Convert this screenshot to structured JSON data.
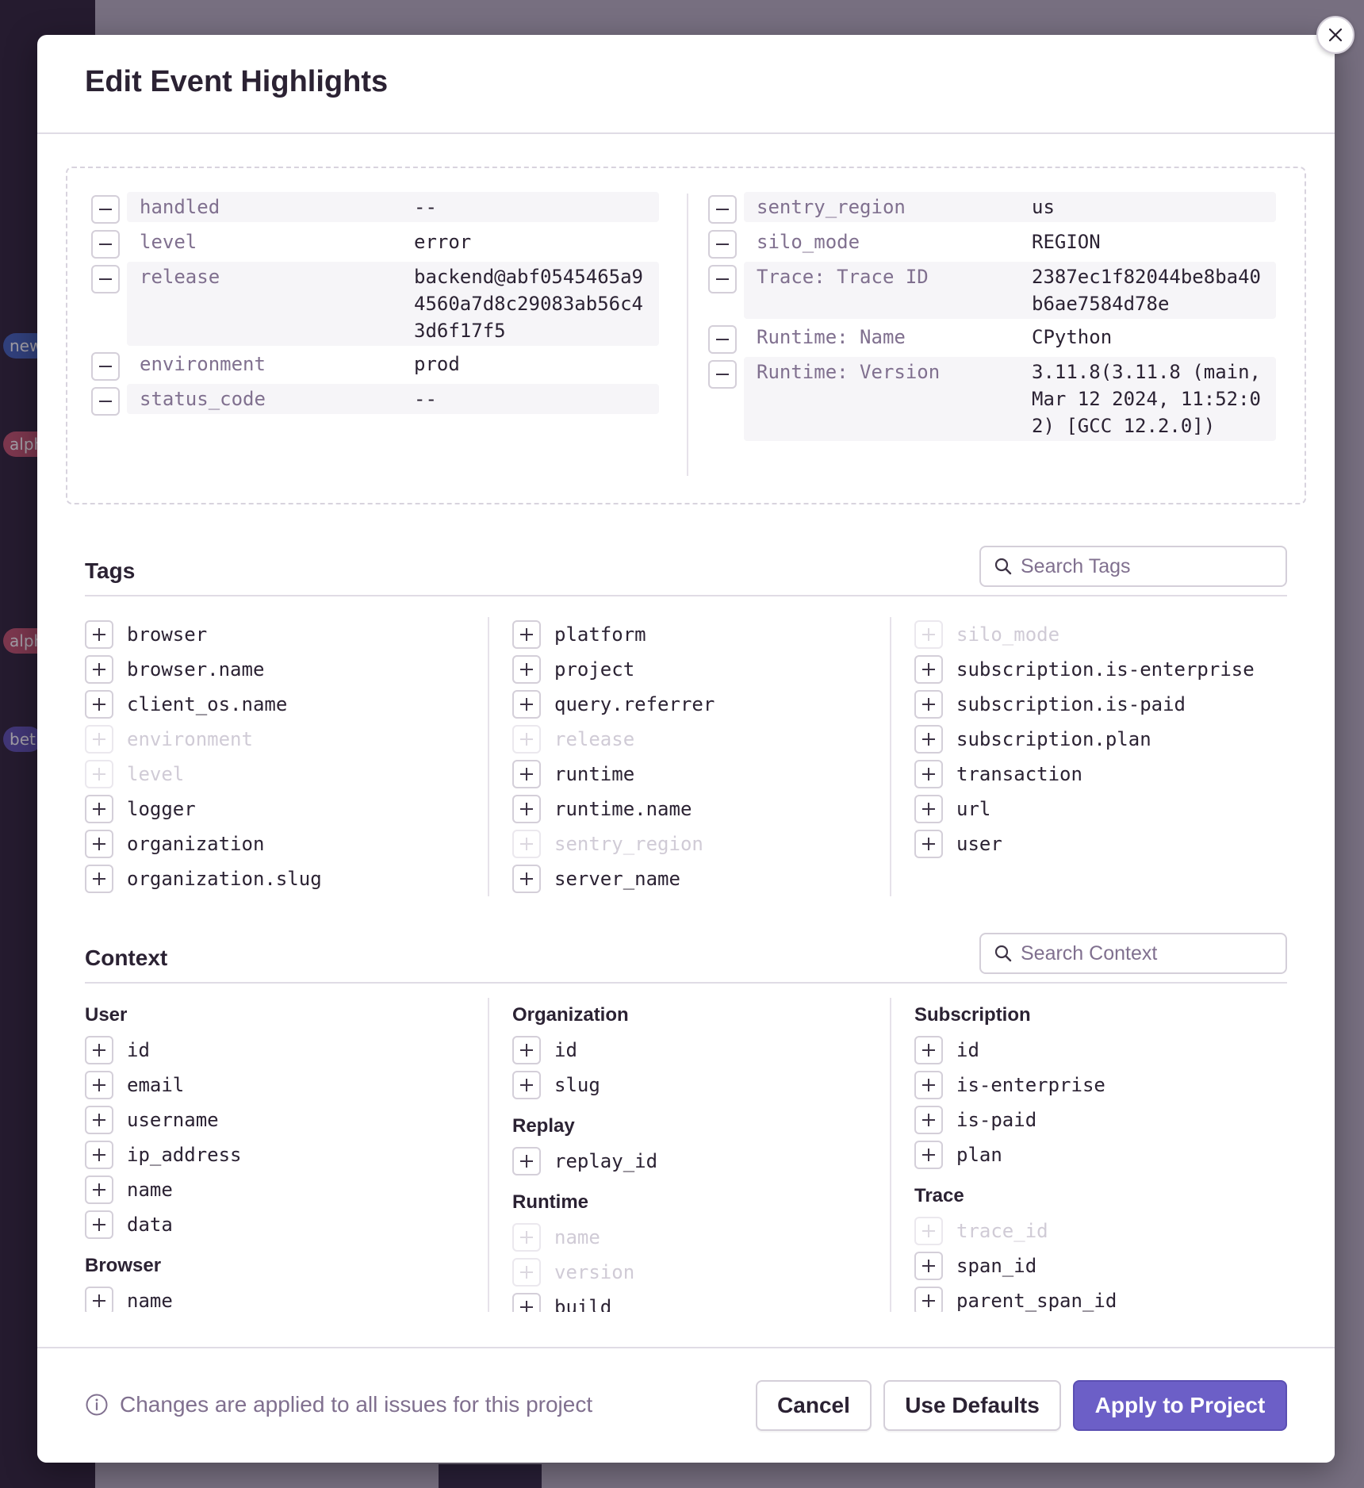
{
  "modal": {
    "title": "Edit Event Highlights"
  },
  "highlights": {
    "left": [
      {
        "key": "handled",
        "value": "--",
        "shaded": true
      },
      {
        "key": "level",
        "value": "error",
        "shaded": false
      },
      {
        "key": "release",
        "value": "backend@abf0545465a94560a7d8c29083ab56c43d6f17f5",
        "shaded": true
      },
      {
        "key": "environment",
        "value": "prod",
        "shaded": false
      },
      {
        "key": "status_code",
        "value": "--",
        "shaded": true
      }
    ],
    "right": [
      {
        "key": "sentry_region",
        "value": "us",
        "shaded": true
      },
      {
        "key": "silo_mode",
        "value": "REGION",
        "shaded": false
      },
      {
        "key": "Trace: Trace ID",
        "value": "2387ec1f82044be8ba40b6ae7584d78e",
        "shaded": true
      },
      {
        "key": "Runtime: Name",
        "value": "CPython",
        "shaded": false
      },
      {
        "key": "Runtime: Version",
        "value": "3.11.8(3.11.8 (main, Mar 12 2024, 11:52:02) [GCC 12.2.0])",
        "shaded": true
      }
    ]
  },
  "tags": {
    "title": "Tags",
    "search_placeholder": "Search Tags",
    "columns": [
      [
        {
          "label": "browser",
          "disabled": false
        },
        {
          "label": "browser.name",
          "disabled": false
        },
        {
          "label": "client_os.name",
          "disabled": false
        },
        {
          "label": "environment",
          "disabled": true
        },
        {
          "label": "level",
          "disabled": true
        },
        {
          "label": "logger",
          "disabled": false
        },
        {
          "label": "organization",
          "disabled": false
        },
        {
          "label": "organization.slug",
          "disabled": false
        }
      ],
      [
        {
          "label": "platform",
          "disabled": false
        },
        {
          "label": "project",
          "disabled": false
        },
        {
          "label": "query.referrer",
          "disabled": false
        },
        {
          "label": "release",
          "disabled": true
        },
        {
          "label": "runtime",
          "disabled": false
        },
        {
          "label": "runtime.name",
          "disabled": false
        },
        {
          "label": "sentry_region",
          "disabled": true
        },
        {
          "label": "server_name",
          "disabled": false
        }
      ],
      [
        {
          "label": "silo_mode",
          "disabled": true
        },
        {
          "label": "subscription.is-enterprise",
          "disabled": false
        },
        {
          "label": "subscription.is-paid",
          "disabled": false
        },
        {
          "label": "subscription.plan",
          "disabled": false
        },
        {
          "label": "transaction",
          "disabled": false
        },
        {
          "label": "url",
          "disabled": false
        },
        {
          "label": "user",
          "disabled": false
        }
      ]
    ]
  },
  "context": {
    "title": "Context",
    "search_placeholder": "Search Context",
    "columns": [
      [
        {
          "group": "User",
          "items": [
            {
              "label": "id",
              "disabled": false
            },
            {
              "label": "email",
              "disabled": false
            },
            {
              "label": "username",
              "disabled": false
            },
            {
              "label": "ip_address",
              "disabled": false
            },
            {
              "label": "name",
              "disabled": false
            },
            {
              "label": "data",
              "disabled": false
            }
          ]
        },
        {
          "group": "Browser",
          "items": [
            {
              "label": "name",
              "disabled": false
            }
          ]
        }
      ],
      [
        {
          "group": "Organization",
          "items": [
            {
              "label": "id",
              "disabled": false
            },
            {
              "label": "slug",
              "disabled": false
            }
          ]
        },
        {
          "group": "Replay",
          "items": [
            {
              "label": "replay_id",
              "disabled": false
            }
          ]
        },
        {
          "group": "Runtime",
          "items": [
            {
              "label": "name",
              "disabled": true
            },
            {
              "label": "version",
              "disabled": true
            },
            {
              "label": "build",
              "disabled": false
            }
          ]
        }
      ],
      [
        {
          "group": "Subscription",
          "items": [
            {
              "label": "id",
              "disabled": false
            },
            {
              "label": "is-enterprise",
              "disabled": false
            },
            {
              "label": "is-paid",
              "disabled": false
            },
            {
              "label": "plan",
              "disabled": false
            }
          ]
        },
        {
          "group": "Trace",
          "items": [
            {
              "label": "trace_id",
              "disabled": true
            },
            {
              "label": "span_id",
              "disabled": false
            },
            {
              "label": "parent_span_id",
              "disabled": false
            }
          ]
        }
      ]
    ]
  },
  "footer": {
    "note": "Changes are applied to all issues for this project",
    "cancel": "Cancel",
    "use_defaults": "Use Defaults",
    "apply": "Apply to Project"
  },
  "background": {
    "pills": [
      {
        "text": "new",
        "color": "#3f5fb8"
      },
      {
        "text": "alph",
        "color": "#c0506a"
      },
      {
        "text": "alph",
        "color": "#c0506a"
      },
      {
        "text": "bet",
        "color": "#5a4fb0"
      }
    ]
  },
  "colors": {
    "primary": "#6c5fc7",
    "muted_text": "#80708f",
    "heading_text": "#2b2233"
  }
}
